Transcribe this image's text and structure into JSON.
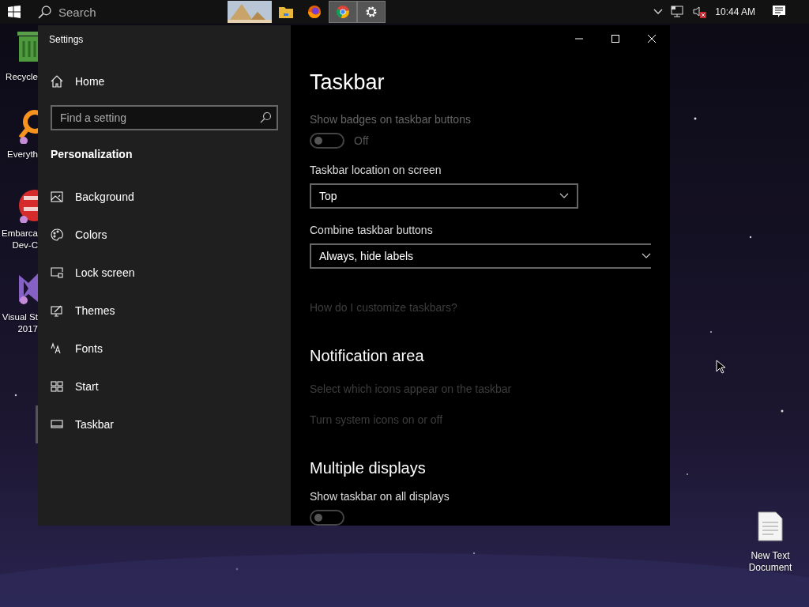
{
  "taskbar": {
    "search_placeholder": "Search",
    "apps": [
      {
        "kind": "picture",
        "selected": false
      },
      {
        "kind": "folder",
        "selected": false
      },
      {
        "kind": "firefox",
        "selected": false
      },
      {
        "kind": "chrome",
        "selected": true
      },
      {
        "kind": "gear",
        "selected": true
      }
    ],
    "clock": "10:44 AM"
  },
  "desktop_icons": [
    {
      "kind": "recycle",
      "lines": [
        "Recycle"
      ]
    },
    {
      "kind": "search-app",
      "lines": [
        "Everyth"
      ]
    },
    {
      "kind": "dev",
      "lines": [
        "Embarca",
        "Dev-C"
      ]
    },
    {
      "kind": "studio",
      "lines": [
        "Visual St",
        "2017"
      ]
    },
    {
      "kind": "document",
      "lines": [
        "New Text Document"
      ]
    }
  ],
  "window": {
    "title": "Settings"
  },
  "sidebar": {
    "home": "Home",
    "search": {
      "placeholder": "Find a setting"
    },
    "section": "Personalization",
    "items": [
      {
        "kind": "background",
        "label": "Background",
        "selected": false
      },
      {
        "kind": "colors",
        "label": "Colors",
        "selected": false
      },
      {
        "kind": "lock",
        "label": "Lock screen",
        "selected": false
      },
      {
        "kind": "themes",
        "label": "Themes",
        "selected": false
      },
      {
        "kind": "fonts",
        "label": "Fonts",
        "selected": false
      },
      {
        "kind": "start",
        "label": "Start",
        "selected": false
      },
      {
        "kind": "taskbar",
        "label": "Taskbar",
        "selected": true
      }
    ]
  },
  "content": {
    "title": "Taskbar",
    "settings": [
      {
        "kind": "toggle",
        "label": "Show badges on taskbar buttons",
        "on": false,
        "state": "Off",
        "disabled": true
      },
      {
        "kind": "dropdown",
        "label": "Taskbar location on screen",
        "value": "Top",
        "wide": false
      },
      {
        "kind": "dropdown",
        "label": "Combine taskbar buttons",
        "value": "Always, hide labels",
        "wide": true
      },
      {
        "kind": "link",
        "label": "How do I customize taskbars?",
        "disabled": true
      },
      {
        "kind": "heading",
        "label": "Notification area"
      },
      {
        "kind": "link",
        "label": "Select which icons appear on the taskbar",
        "disabled": true
      },
      {
        "kind": "link",
        "label": "Turn system icons on or off",
        "disabled": true
      },
      {
        "kind": "heading",
        "label": "Multiple displays"
      },
      {
        "kind": "toggle",
        "label": "Show taskbar on all displays",
        "on": false,
        "disabled": false
      }
    ]
  }
}
